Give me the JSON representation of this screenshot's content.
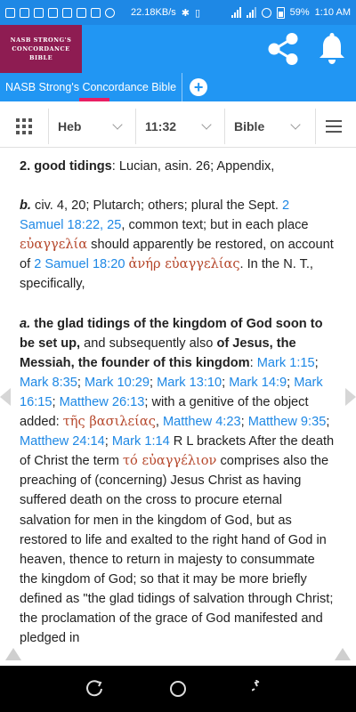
{
  "status_bar": {
    "network_speed": "22.18KB/s",
    "battery": "59%",
    "time": "1:10 AM"
  },
  "app": {
    "logo_lines": [
      "NASB STRONG'S",
      "CONCORDANCE",
      "BIBLE"
    ],
    "accent_color": "#2196f3",
    "logo_color": "#8e1c52"
  },
  "tabs": {
    "active_label": "NASB Strong's Concordance Bible",
    "add_label": "+"
  },
  "toolbar": {
    "language": "Heb",
    "reference": "11:32",
    "source": "Bible"
  },
  "content": {
    "p1_num": "2.",
    "p1_bold": "good tidings",
    "p1_rest": ": Lucian, asin. 26; Appendix,",
    "p2_label": "b.",
    "p2_t1": " civ. 4, 20; Plutarch; others; plural the Sept. ",
    "p2_ref1": "2 Samuel 18:22, 25",
    "p2_t2": ", common text; but in each place ",
    "p2_greek1": "εὐαγγελία",
    "p2_t3": " should apparently be restored, on account of ",
    "p2_ref2": "2 Samuel 18:20",
    "p2_t4": " ",
    "p2_greek2": "ἀνήρ εὐαγγελίας",
    "p2_t5": ". In the N. T., specifically,",
    "p3_label": "a.",
    "p3_b1": " the glad tidings of the kingdom of God soon to be set up,",
    "p3_t1": " and subsequently also ",
    "p3_b2": "of Jesus, the Messiah, the founder of this kingdom",
    "p3_t2": ": ",
    "p3_r1": "Mark 1:15",
    "p3_s1": "; ",
    "p3_r2": "Mark 8:35",
    "p3_s2": "; ",
    "p3_r3": "Mark 10:29",
    "p3_s3": "; ",
    "p3_r4": "Mark 13:10",
    "p3_s4": "; ",
    "p3_r5": "Mark 14:9",
    "p3_s5": "; ",
    "p3_r6": "Mark 16:15",
    "p3_s6": "; ",
    "p3_r7": "Matthew 26:13",
    "p3_t3": "; with a genitive of the object added: ",
    "p3_g1": "τῆς βασιλείας",
    "p3_s7": ", ",
    "p3_r8": "Matthew 4:23",
    "p3_s8": "; ",
    "p3_r9": "Matthew 9:35",
    "p3_s9": "; ",
    "p3_r10": "Matthew 24:14",
    "p3_s10": "; ",
    "p3_r11": "Mark 1:14",
    "p3_t4": " R L brackets After the death of Christ the term ",
    "p3_g2": "τό εὐαγγέλιον",
    "p3_t5": " comprises also the preaching of (concerning) Jesus Christ as having suffered death on the cross to procure eternal salvation for men in the kingdom of God, but as restored to life and exalted to the right hand of God in heaven, thence to return in majesty to consummate the kingdom of God; so that it may be more briefly defined as \"the glad tidings of salvation through Christ; the proclamation of the grace of God manifested and pledged in"
  }
}
